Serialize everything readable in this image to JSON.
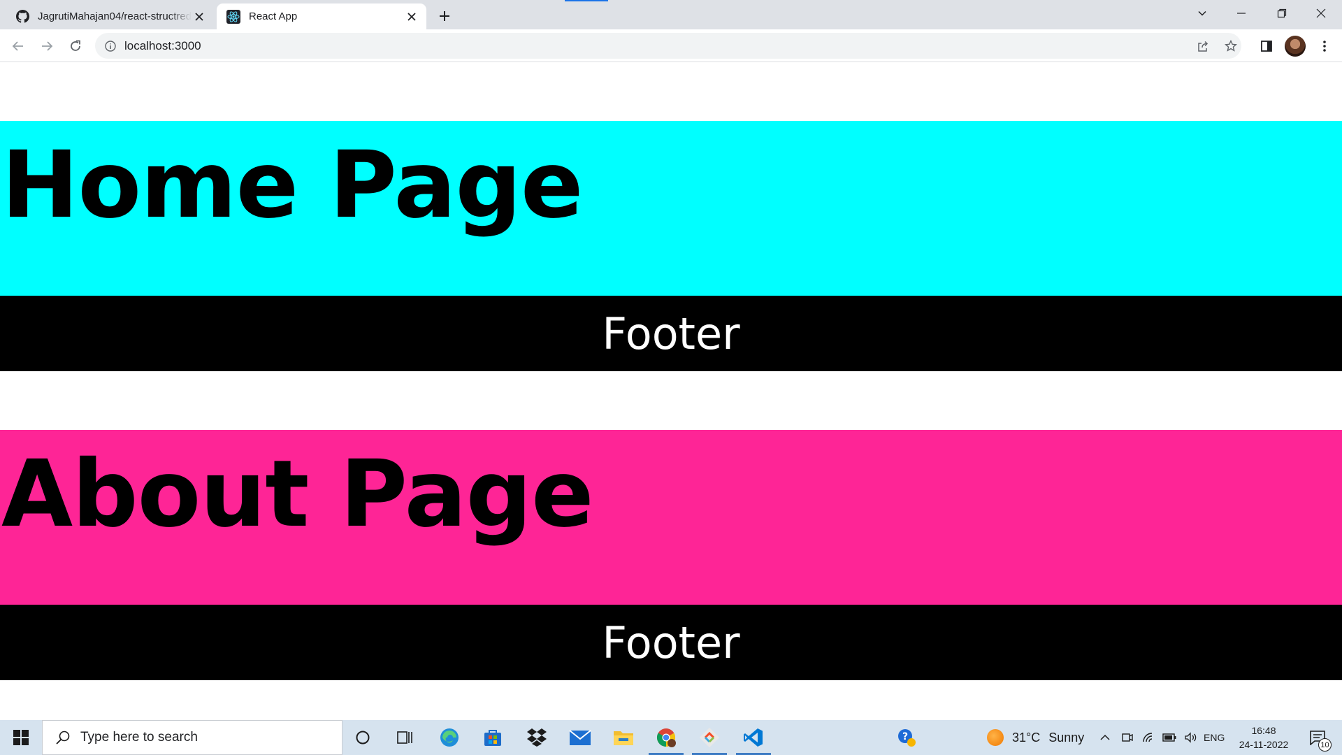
{
  "browser": {
    "tabs": [
      {
        "title": "JagrutiMahajan04/react-structred",
        "active": false,
        "icon": "github-icon"
      },
      {
        "title": "React App",
        "active": true,
        "icon": "react-icon"
      }
    ],
    "address": "localhost:3000"
  },
  "page": {
    "sections": [
      {
        "heading": "Home Page",
        "bg": "#00ffff",
        "footer": "Footer"
      },
      {
        "heading": "About Page",
        "bg": "#fe2596",
        "footer": "Footer"
      }
    ]
  },
  "taskbar": {
    "search_placeholder": "Type here to search",
    "apps": [
      "cortana-icon",
      "task-view-icon",
      "edge-icon",
      "store-icon",
      "dropbox-icon",
      "mail-icon",
      "file-explorer-icon",
      "chrome-icon",
      "git-icon",
      "vscode-icon",
      "help-icon"
    ],
    "weather": {
      "temp": "31°C",
      "condition": "Sunny"
    },
    "language": "ENG",
    "time": "16:48",
    "date": "24-11-2022",
    "notification_count": "10"
  },
  "colors": {
    "footer_bg": "#000000",
    "footer_text": "#ffffff",
    "taskbar_bg": "#d6e3ef",
    "tabstrip_bg": "#dee1e6"
  }
}
